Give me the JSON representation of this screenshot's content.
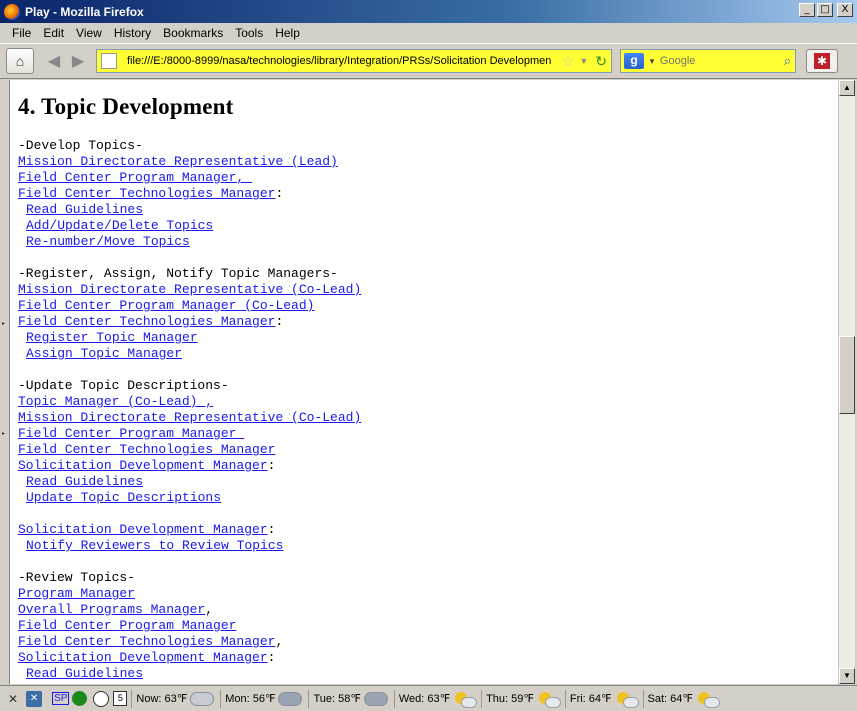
{
  "window": {
    "title": "Play - Mozilla Firefox",
    "controls": {
      "minimize": "_",
      "maximize": "□",
      "close": "X"
    }
  },
  "menu": [
    "File",
    "Edit",
    "View",
    "History",
    "Bookmarks",
    "Tools",
    "Help"
  ],
  "toolbar": {
    "url": "file:///E:/8000-8999/nasa/technologies/library/Integration/PRSs/Solicitation Developmen",
    "search_placeholder": "Google"
  },
  "page": {
    "heading": "4. Topic Development",
    "blocks": [
      {
        "header": "-Develop Topics-",
        "roles": [
          {
            "text": "Mission Directorate Representative (Lead)",
            "suffix": ""
          },
          {
            "text": "Field Center Program Manager, ",
            "suffix": ""
          },
          {
            "text": "Field Center Technologies Manager",
            "suffix": ":"
          }
        ],
        "tasks": [
          "Read Guidelines",
          "Add/Update/Delete Topics",
          "Re-number/Move Topics"
        ]
      },
      {
        "header": "-Register, Assign, Notify Topic Managers-",
        "roles": [
          {
            "text": "Mission Directorate Representative (Co-Lead)",
            "suffix": ""
          },
          {
            "text": "Field Center Program Manager (Co-Lead)",
            "suffix": ""
          },
          {
            "text": "Field Center Technologies Manager",
            "suffix": ":"
          }
        ],
        "tasks": [
          "Register Topic Manager",
          "Assign Topic Manager"
        ]
      },
      {
        "header": "-Update Topic Descriptions-",
        "roles": [
          {
            "text": "Topic Manager (Co-Lead) ,",
            "suffix": ""
          },
          {
            "text": "Mission Directorate Representative (Co-Lead)",
            "suffix": ""
          },
          {
            "text": "Field Center Program Manager ",
            "suffix": ""
          },
          {
            "text": "Field Center Technologies Manager",
            "suffix": ""
          },
          {
            "text": "Solicitation Development Manager",
            "suffix": ":"
          }
        ],
        "tasks": [
          "Read Guidelines",
          "Update Topic Descriptions"
        ]
      },
      {
        "header": "",
        "roles": [
          {
            "text": "Solicitation Development Manager",
            "suffix": ":"
          }
        ],
        "tasks": [
          "Notify Reviewers to Review Topics"
        ]
      },
      {
        "header": "-Review Topics-",
        "roles": [
          {
            "text": "Program Manager",
            "suffix": ""
          },
          {
            "text": "Overall Programs Manager",
            "suffix": ","
          },
          {
            "text": "Field Center Program Manager",
            "suffix": ""
          },
          {
            "text": "Field Center Technologies Manager",
            "suffix": ","
          },
          {
            "text": "Solicitation Development Manager",
            "suffix": ":"
          }
        ],
        "tasks": [
          "Read Guidelines"
        ]
      }
    ]
  },
  "statusbar": {
    "calendar_day": "5",
    "sp_label": "SP",
    "weather": [
      {
        "label": "Now: 63℉",
        "icon": "cloud-icon"
      },
      {
        "label": "Mon: 56℉",
        "icon": "rain-cloud-icon"
      },
      {
        "label": "Tue: 58℉",
        "icon": "rain-cloud-icon"
      },
      {
        "label": "Wed: 63℉",
        "icon": "partly-cloudy-icon"
      },
      {
        "label": "Thu: 59℉",
        "icon": "partly-sunny-icon"
      },
      {
        "label": "Fri: 64℉",
        "icon": "partly-sunny-icon"
      },
      {
        "label": "Sat: 64℉",
        "icon": "partly-sunny-icon"
      }
    ]
  }
}
